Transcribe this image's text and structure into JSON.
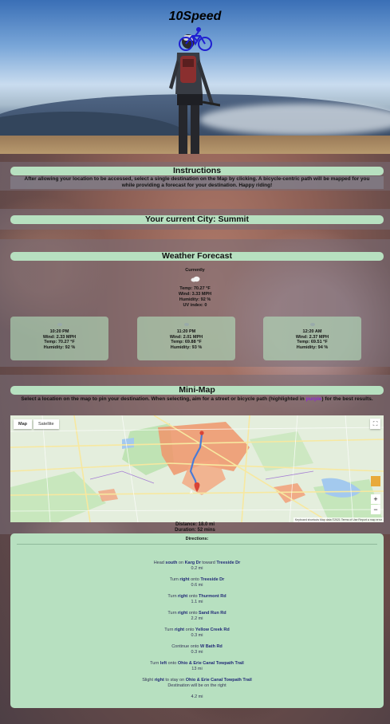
{
  "app": {
    "title": "10Speed"
  },
  "instructions": {
    "header": "Instructions",
    "text": "After allowing your location to be accessed, select a single destination on the Map by clicking. A bicycle-centric path will be mapped for you while providing a forecast for your destination. Happy riding!"
  },
  "city": {
    "label": "Your current City: Summit"
  },
  "weather": {
    "header": "Weather Forecast",
    "current": {
      "label": "Currently",
      "temp": "Temp: 70.27 °F",
      "wind": "Wind: 3.33 MPH",
      "humidity": "Humidity: 92 %",
      "uv": "UV index: 0"
    },
    "forecast": [
      {
        "time": "10:20 PM",
        "line1": "Wind: 2.33 MPH",
        "line2": "Temp: 70.27 °F",
        "line3": "Humidity: 92 %"
      },
      {
        "time": "11:20 PM",
        "line1": "Wind: 2.01 MPH",
        "line2": "Temp: 69.88 °F",
        "line3": "Humidity: 93 %"
      },
      {
        "time": "12:20 AM",
        "line1": "Wind: 2.37 MPH",
        "line2": "Temp: 69.51 °F",
        "line3": "Humidity: 94 %"
      }
    ]
  },
  "minimap": {
    "header": "Mini-Map",
    "desc_before": "Select a location on the map to pin your destination. When selecting, aim for a street or bicycle path (highlighted in ",
    "desc_highlight": "purple",
    "desc_after": ") for the best results.",
    "tab_map": "Map",
    "tab_satellite": "Satellite",
    "labels": {
      "marker_a": "A",
      "marker_b": "B",
      "footer_shortcuts": "Keyboard shortcuts",
      "footer_data": "Map data ©2021",
      "footer_terms": "Terms of Use",
      "footer_report": "Report a map error",
      "zoom_in": "+",
      "zoom_out": "−"
    }
  },
  "route": {
    "distance": "Distance: 18.0 mi",
    "duration": "Duration: 52 mins"
  },
  "directions": {
    "title": "Directions:",
    "steps": [
      {
        "pre": "Head ",
        "a": "south",
        "mid": " on ",
        "b": "Karg Dr",
        "post": " toward ",
        "c": "Treeside Dr",
        "note": "",
        "dist": "0.2 mi"
      },
      {
        "pre": "Turn ",
        "a": "right",
        "mid": " onto ",
        "b": "Treeside Dr",
        "post": "",
        "c": "",
        "note": "",
        "dist": "0.6 mi"
      },
      {
        "pre": "Turn ",
        "a": "right",
        "mid": " onto ",
        "b": "Thurmont Rd",
        "post": "",
        "c": "",
        "note": "",
        "dist": "1.1 mi"
      },
      {
        "pre": "Turn ",
        "a": "right",
        "mid": " onto ",
        "b": "Sand Run Rd",
        "post": "",
        "c": "",
        "note": "",
        "dist": "2.2 mi"
      },
      {
        "pre": "Turn ",
        "a": "right",
        "mid": " onto ",
        "b": "Yellow Creek Rd",
        "post": "",
        "c": "",
        "note": "",
        "dist": "0.3 mi"
      },
      {
        "pre": "Continue onto ",
        "a": "",
        "mid": "",
        "b": "W Bath Rd",
        "post": "",
        "c": "",
        "note": "",
        "dist": "0.3 mi"
      },
      {
        "pre": "Turn ",
        "a": "left",
        "mid": " onto ",
        "b": "Ohio & Erie Canal Towpath Trail",
        "post": "",
        "c": "",
        "note": "",
        "dist": "13 mi"
      },
      {
        "pre": "Slight ",
        "a": "right",
        "mid": " to stay on ",
        "b": "Ohio & Erie Canal Towpath Trail",
        "post": "",
        "c": "",
        "note": "Destination will be on the right",
        "dist": "4.2 mi"
      }
    ]
  },
  "colors": {
    "panel_green": "#b7e0c0",
    "route_blue": "#4a7bd6",
    "bike_icon": "#1f1fd1"
  }
}
